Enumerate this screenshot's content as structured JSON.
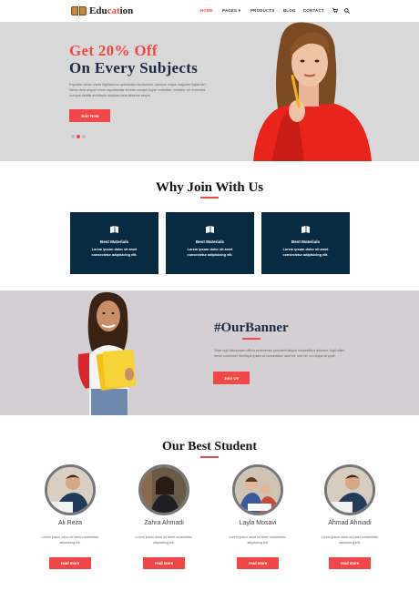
{
  "nav": {
    "logo_pre": "Edu",
    "logo_acc": "cat",
    "logo_post": "ion",
    "items": [
      "HOME",
      "PAGES ▾",
      "PRODUCTS",
      "BLOG",
      "CONTACT"
    ],
    "active_index": 0,
    "cart_icon": "cart-icon",
    "search_icon": "search-icon"
  },
  "hero": {
    "title_line1": "Get 20% Off",
    "title_line2": "On Every Subjects",
    "description": "Expedita minus omnis dignissimos quibusdam laudantium, laborum neque magnam fugiat hic? Nemo dicta aliquid rerum repudiandae tenetur suscipit fugiat molestiae, veritatis, vel molestias cumque debitis architecto voluptas iusto laborum neque.",
    "button": "Join Now",
    "slides": 3,
    "active_slide": 1
  },
  "why": {
    "title": "Why Join With Us",
    "cards": [
      {
        "icon": "book-icon",
        "title": "Best Materials",
        "desc": "Lorem ipsum dolor sit amet consectetur adipisicing elit."
      },
      {
        "icon": "book-icon",
        "title": "Best Materials",
        "desc": "Lorem ipsum dolor sit amet consectetur adipisicing elit."
      },
      {
        "icon": "book-icon",
        "title": "Best Materials",
        "desc": "Lorem ipsum dolor sit amet consectetur adipisicing elit."
      }
    ]
  },
  "banner": {
    "title": "#OurBanner",
    "description": "Vitae fugit laboriosam officia perferendis provident aliquid voluptatibus dolorem, fugit ullam rerum commodi! Similique ipsam ut consectetur nam vel, sint vel, ea neque sit quae.",
    "button": "Join Us"
  },
  "students": {
    "title": "Our Best Student",
    "items": [
      {
        "name": "Ali Reza",
        "desc": "Lorem ipsum dolor sit amet consectetur adipisicing elit.",
        "button": "read more"
      },
      {
        "name": "Zahra Ahmadi",
        "desc": "Lorem ipsum dolor sit amet consectetur adipisicing elit.",
        "button": "read more"
      },
      {
        "name": "Layla Mosavi",
        "desc": "Lorem ipsum dolor sit amet consectetur adipisicing elit.",
        "button": "read more"
      },
      {
        "name": "Ahmad Ahmadi",
        "desc": "Lorem ipsum dolor sit amet consectetur adipisicing elit.",
        "button": "read more"
      }
    ]
  },
  "colors": {
    "accent": "#f04848",
    "navy": "#082b42",
    "hero_bg": "#d8d8d8",
    "banner_bg": "#d4cfd2"
  }
}
